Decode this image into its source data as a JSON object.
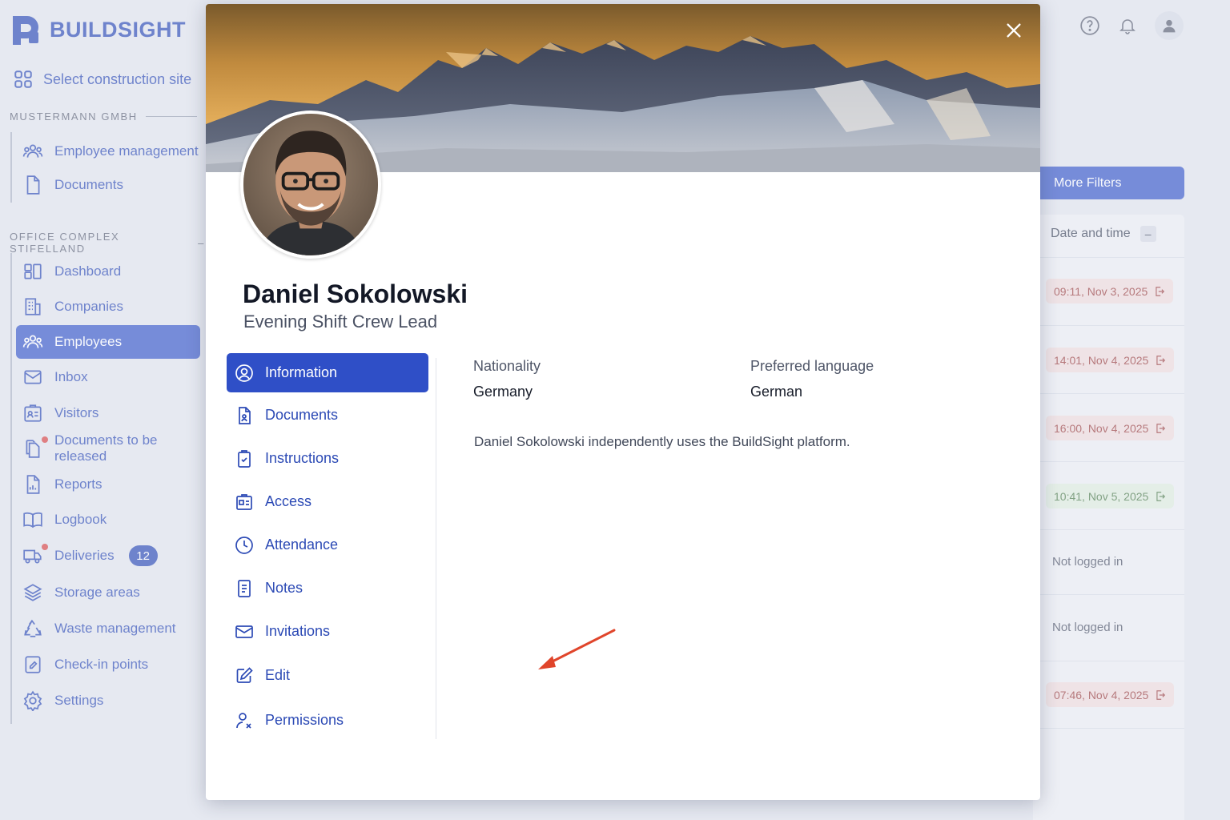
{
  "brand": {
    "name": "BUILDSIGHT"
  },
  "site_select": {
    "label": "Select construction site"
  },
  "sections": [
    {
      "title": "MUSTERMANN GMBH",
      "items": [
        {
          "label": "Employee management",
          "icon": "users-icon"
        },
        {
          "label": "Documents",
          "icon": "file-icon"
        }
      ]
    },
    {
      "title": "OFFICE COMPLEX STIFELLAND",
      "collapse": "–",
      "items": [
        {
          "label": "Dashboard",
          "icon": "dashboard-icon"
        },
        {
          "label": "Companies",
          "icon": "building-icon"
        },
        {
          "label": "Employees",
          "icon": "users-icon",
          "active": true
        },
        {
          "label": "Inbox",
          "icon": "mail-icon"
        },
        {
          "label": "Visitors",
          "icon": "visitor-badge-icon"
        },
        {
          "label": "Documents to be released",
          "icon": "documents-icon",
          "dot": true
        },
        {
          "label": "Reports",
          "icon": "report-icon"
        },
        {
          "label": "Logbook",
          "icon": "book-icon"
        },
        {
          "label": "Deliveries",
          "icon": "truck-icon",
          "dot": true,
          "badge": "12"
        },
        {
          "label": "Storage areas",
          "icon": "layers-icon"
        },
        {
          "label": "Waste management",
          "icon": "recycle-icon"
        },
        {
          "label": "Check-in points",
          "icon": "checkin-icon"
        },
        {
          "label": "Settings",
          "icon": "gear-icon"
        }
      ]
    }
  ],
  "toolbar": {
    "more_filters": "More Filters"
  },
  "table": {
    "column": "Date and time",
    "collapse": "–",
    "rows": [
      {
        "value": "09:11, Nov 3, 2025",
        "status": "red"
      },
      {
        "value": "14:01, Nov 4, 2025",
        "status": "red"
      },
      {
        "value": "16:00, Nov 4, 2025",
        "status": "red"
      },
      {
        "value": "10:41, Nov 5, 2025",
        "status": "green"
      },
      {
        "value": "Not logged in",
        "status": "none"
      },
      {
        "value": "Not logged in",
        "status": "none"
      },
      {
        "value": "07:46, Nov 4, 2025",
        "status": "red"
      }
    ]
  },
  "modal": {
    "name": "Daniel Sokolowski",
    "role": "Evening Shift Crew Lead",
    "tabs": [
      {
        "label": "Information",
        "icon": "user-circle-icon",
        "active": true
      },
      {
        "label": "Documents",
        "icon": "file-person-icon"
      },
      {
        "label": "Instructions",
        "icon": "clipboard-check-icon"
      },
      {
        "label": "Access",
        "icon": "id-card-icon"
      },
      {
        "label": "Attendance",
        "icon": "clock-icon"
      },
      {
        "label": "Notes",
        "icon": "note-icon"
      },
      {
        "label": "Invitations",
        "icon": "envelope-icon"
      },
      {
        "label": "Edit",
        "icon": "pencil-icon"
      },
      {
        "label": "Permissions",
        "icon": "user-x-icon"
      }
    ],
    "fields": {
      "nationality_label": "Nationality",
      "nationality_value": "Germany",
      "language_label": "Preferred language",
      "language_value": "German"
    },
    "note": "Daniel Sokolowski independently uses the BuildSight platform."
  },
  "colors": {
    "accent": "#2f4fc7",
    "annotation_arrow": "#e0452b"
  }
}
